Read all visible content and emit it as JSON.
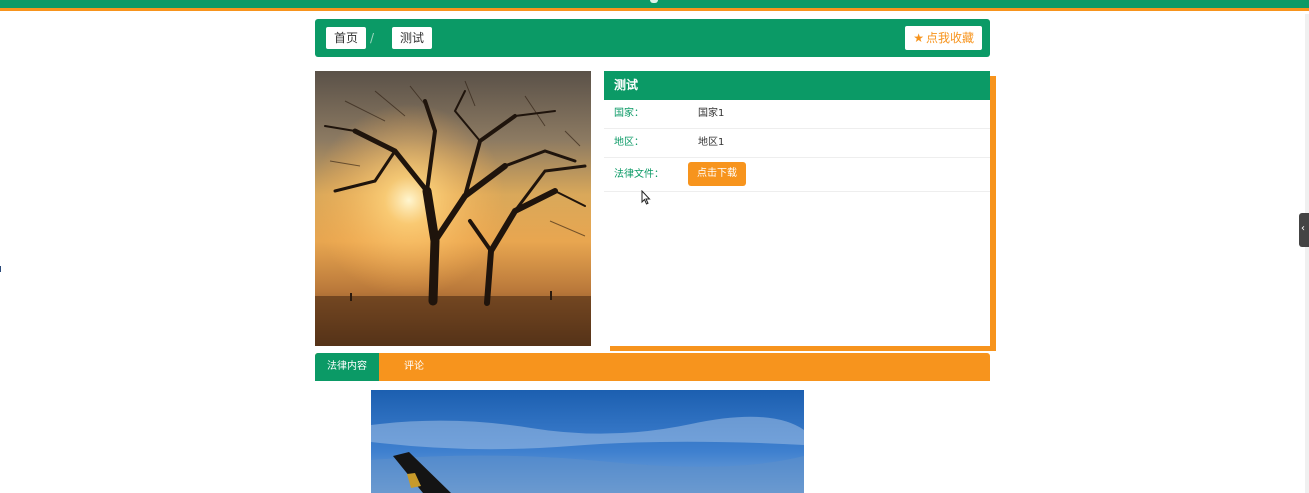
{
  "breadcrumb": {
    "home": "首页",
    "separator": "/",
    "current": "测试"
  },
  "favorite_button": {
    "label": "点我收藏",
    "icon": "star-icon"
  },
  "detail": {
    "title": "测试",
    "rows": [
      {
        "label": "国家：",
        "value": "国家1"
      },
      {
        "label": "地区：",
        "value": "地区1"
      }
    ],
    "file_label": "法律文件：",
    "download_label": "点击下载"
  },
  "tabs": [
    {
      "label": "法律内容",
      "active": true
    },
    {
      "label": "评论",
      "active": false
    }
  ],
  "colors": {
    "primary": "#0b9a66",
    "accent": "#f7941d"
  }
}
